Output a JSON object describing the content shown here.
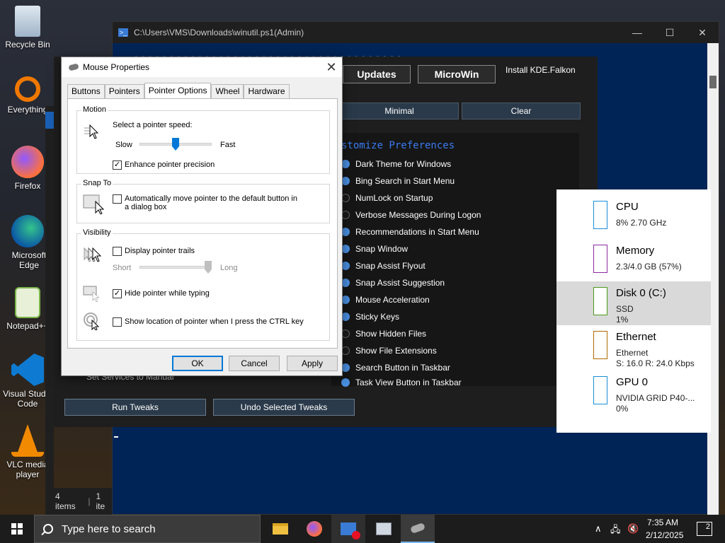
{
  "desktop": {
    "icons": [
      {
        "label": "Recycle Bin"
      },
      {
        "label": "Everything"
      },
      {
        "label": "Firefox"
      },
      {
        "label": "Microsoft Edge"
      },
      {
        "label": "Notepad++"
      },
      {
        "label": "Visual Studio Code"
      },
      {
        "label": "VLC media player"
      }
    ]
  },
  "powershell": {
    "title": "C:\\Users\\VMS\\Downloads\\winutil.ps1(Admin)",
    "controls": [
      "—",
      "☐",
      "✕"
    ]
  },
  "winutil": {
    "top_buttons": {
      "updates": "Updates",
      "microwin": "MicroWin"
    },
    "install_text": "Install KDE.Falkon",
    "preset_buttons": {
      "minimal": "Minimal",
      "clear": "Clear"
    },
    "heading": "stomize Preferences",
    "preferences": [
      {
        "label": "Dark Theme for Windows",
        "on": true
      },
      {
        "label": "Bing Search in Start Menu",
        "on": true
      },
      {
        "label": "NumLock on Startup",
        "on": false
      },
      {
        "label": "Verbose Messages During Logon",
        "on": false
      },
      {
        "label": "Recommendations in Start Menu",
        "on": true
      },
      {
        "label": "Snap Window",
        "on": true
      },
      {
        "label": "Snap Assist Flyout",
        "on": true
      },
      {
        "label": "Snap Assist Suggestion",
        "on": true
      },
      {
        "label": "Mouse Acceleration",
        "on": true
      },
      {
        "label": "Sticky Keys",
        "on": true
      },
      {
        "label": "Show Hidden Files",
        "on": false
      },
      {
        "label": "Show File Extensions",
        "on": false
      },
      {
        "label": "Search Button in Taskbar",
        "on": true
      },
      {
        "label": "Task View Button in Taskbar",
        "on": true
      }
    ],
    "ghost_text": "Set Services to Manual",
    "bottom_buttons": {
      "run": "Run Tweaks",
      "undo": "Undo Selected Tweaks"
    }
  },
  "explorer": {
    "status_items": "4 items",
    "status_sel": "1 ite"
  },
  "taskmanager": {
    "rows": [
      {
        "name": "CPU",
        "line1": "8% 2.70 GHz",
        "line2": "",
        "color": "#1a8fd6"
      },
      {
        "name": "Memory",
        "line1": "2.3/4.0 GB (57%)",
        "line2": "",
        "color": "#8b2aa3"
      },
      {
        "name": "Disk 0 (C:)",
        "line1": "SSD",
        "line2": "1%",
        "color": "#4b9a1c"
      },
      {
        "name": "Ethernet",
        "line1": "Ethernet",
        "line2": "S: 16.0  R: 24.0 Kbps",
        "color": "#b06a00"
      },
      {
        "name": "GPU 0",
        "line1": "NVIDIA GRID P40-...",
        "line2": "0%",
        "color": "#1a8fd6"
      }
    ]
  },
  "dialog": {
    "title": "Mouse Properties",
    "close": "✕",
    "tabs": [
      "Buttons",
      "Pointers",
      "Pointer Options",
      "Wheel",
      "Hardware"
    ],
    "active_tab": "Pointer Options",
    "motion": {
      "title": "Motion",
      "speed_label": "Select a pointer speed:",
      "slow": "Slow",
      "fast": "Fast",
      "speed_value": 0.5,
      "enhance_label": "Enhance pointer precision",
      "enhance_checked": true
    },
    "snap": {
      "title": "Snap To",
      "label": "Automatically move pointer to the default button in a dialog box",
      "checked": false
    },
    "visibility": {
      "title": "Visibility",
      "trails_label": "Display pointer trails",
      "trails_checked": false,
      "short": "Short",
      "long": "Long",
      "trail_value": 1.0,
      "hide_label": "Hide pointer while typing",
      "hide_checked": true,
      "ctrl_label": "Show location of pointer when I press the CTRL key",
      "ctrl_checked": false
    },
    "buttons": {
      "ok": "OK",
      "cancel": "Cancel",
      "apply": "Apply"
    }
  },
  "taskbar": {
    "search_placeholder": "Type here to search",
    "time": "7:35 AM",
    "date": "2/12/2025",
    "notification_count": "2"
  }
}
